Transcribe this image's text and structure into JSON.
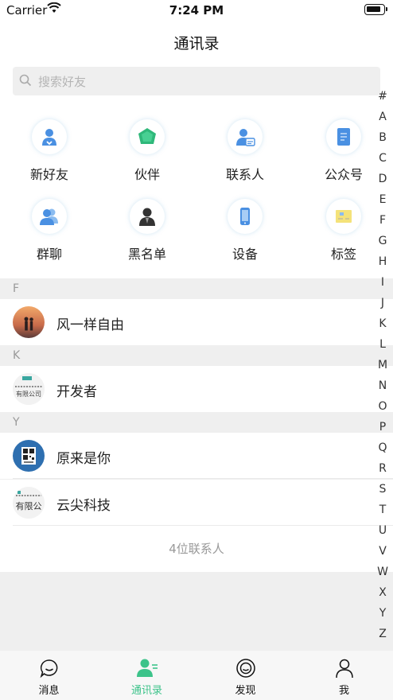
{
  "status_bar": {
    "carrier": "Carrier",
    "time": "7:24 PM"
  },
  "nav": {
    "title": "通讯录"
  },
  "search": {
    "placeholder": "搜索好友"
  },
  "grid": [
    {
      "label": "新好友",
      "icon": "person-add-icon"
    },
    {
      "label": "伙伴",
      "icon": "partner-icon"
    },
    {
      "label": "联系人",
      "icon": "contact-card-icon"
    },
    {
      "label": "公众号",
      "icon": "official-account-icon"
    },
    {
      "label": "群聊",
      "icon": "group-chat-icon"
    },
    {
      "label": "黑名单",
      "icon": "blacklist-icon"
    },
    {
      "label": "设备",
      "icon": "device-icon"
    },
    {
      "label": "标签",
      "icon": "tag-icon"
    }
  ],
  "index_letters": [
    "#",
    "A",
    "B",
    "C",
    "D",
    "E",
    "F",
    "G",
    "H",
    "I",
    "J",
    "K",
    "L",
    "M",
    "N",
    "O",
    "P",
    "Q",
    "R",
    "S",
    "T",
    "U",
    "V",
    "W",
    "X",
    "Y",
    "Z"
  ],
  "sections": [
    {
      "letter": "F",
      "contacts": [
        {
          "name": "风一样自由"
        }
      ]
    },
    {
      "letter": "K",
      "contacts": [
        {
          "name": "开发者",
          "avatar_text": "有限公司"
        }
      ]
    },
    {
      "letter": "Y",
      "contacts": [
        {
          "name": "原来是你"
        },
        {
          "name": "云尖科技",
          "avatar_text": "有限公"
        }
      ]
    }
  ],
  "footer": {
    "count_text": "4位联系人"
  },
  "tabs": [
    {
      "label": "消息",
      "icon": "chat-bubble-icon"
    },
    {
      "label": "通讯录",
      "icon": "contacts-icon",
      "active": true
    },
    {
      "label": "发现",
      "icon": "discover-icon"
    },
    {
      "label": "我",
      "icon": "profile-icon"
    }
  ],
  "colors": {
    "accent": "#3cc38a",
    "icon_blue": "#4a90e2",
    "background": "#efefef"
  }
}
